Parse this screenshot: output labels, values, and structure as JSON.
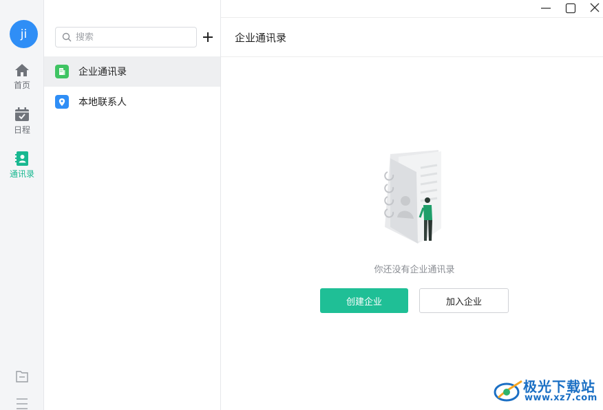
{
  "user": {
    "avatar_text": "ji"
  },
  "nav": {
    "items": [
      {
        "label": "首页",
        "icon": "home-icon"
      },
      {
        "label": "日程",
        "icon": "calendar-icon"
      },
      {
        "label": "通讯录",
        "icon": "contacts-icon",
        "active": true
      }
    ],
    "bottom_icons": [
      "folder-icon",
      "menu-icon"
    ]
  },
  "search": {
    "placeholder": "搜索"
  },
  "contact_groups": [
    {
      "label": "企业通讯录",
      "icon": "building-icon",
      "color": "#3fc463",
      "selected": true
    },
    {
      "label": "本地联系人",
      "icon": "location-pin-icon",
      "color": "#2f8ef6",
      "selected": false
    }
  ],
  "main": {
    "title": "企业通讯录",
    "empty_message": "你还没有企业通讯录",
    "create_button": "创建企业",
    "join_button": "加入企业"
  },
  "window_controls": [
    "minimize-icon",
    "maximize-icon",
    "close-icon"
  ],
  "watermark": {
    "title": "极光下载站",
    "url": "www.xz7.com"
  },
  "colors": {
    "accent": "#1fbf96",
    "avatar": "#2f8ef6",
    "watermark": "#1a6fc4"
  }
}
